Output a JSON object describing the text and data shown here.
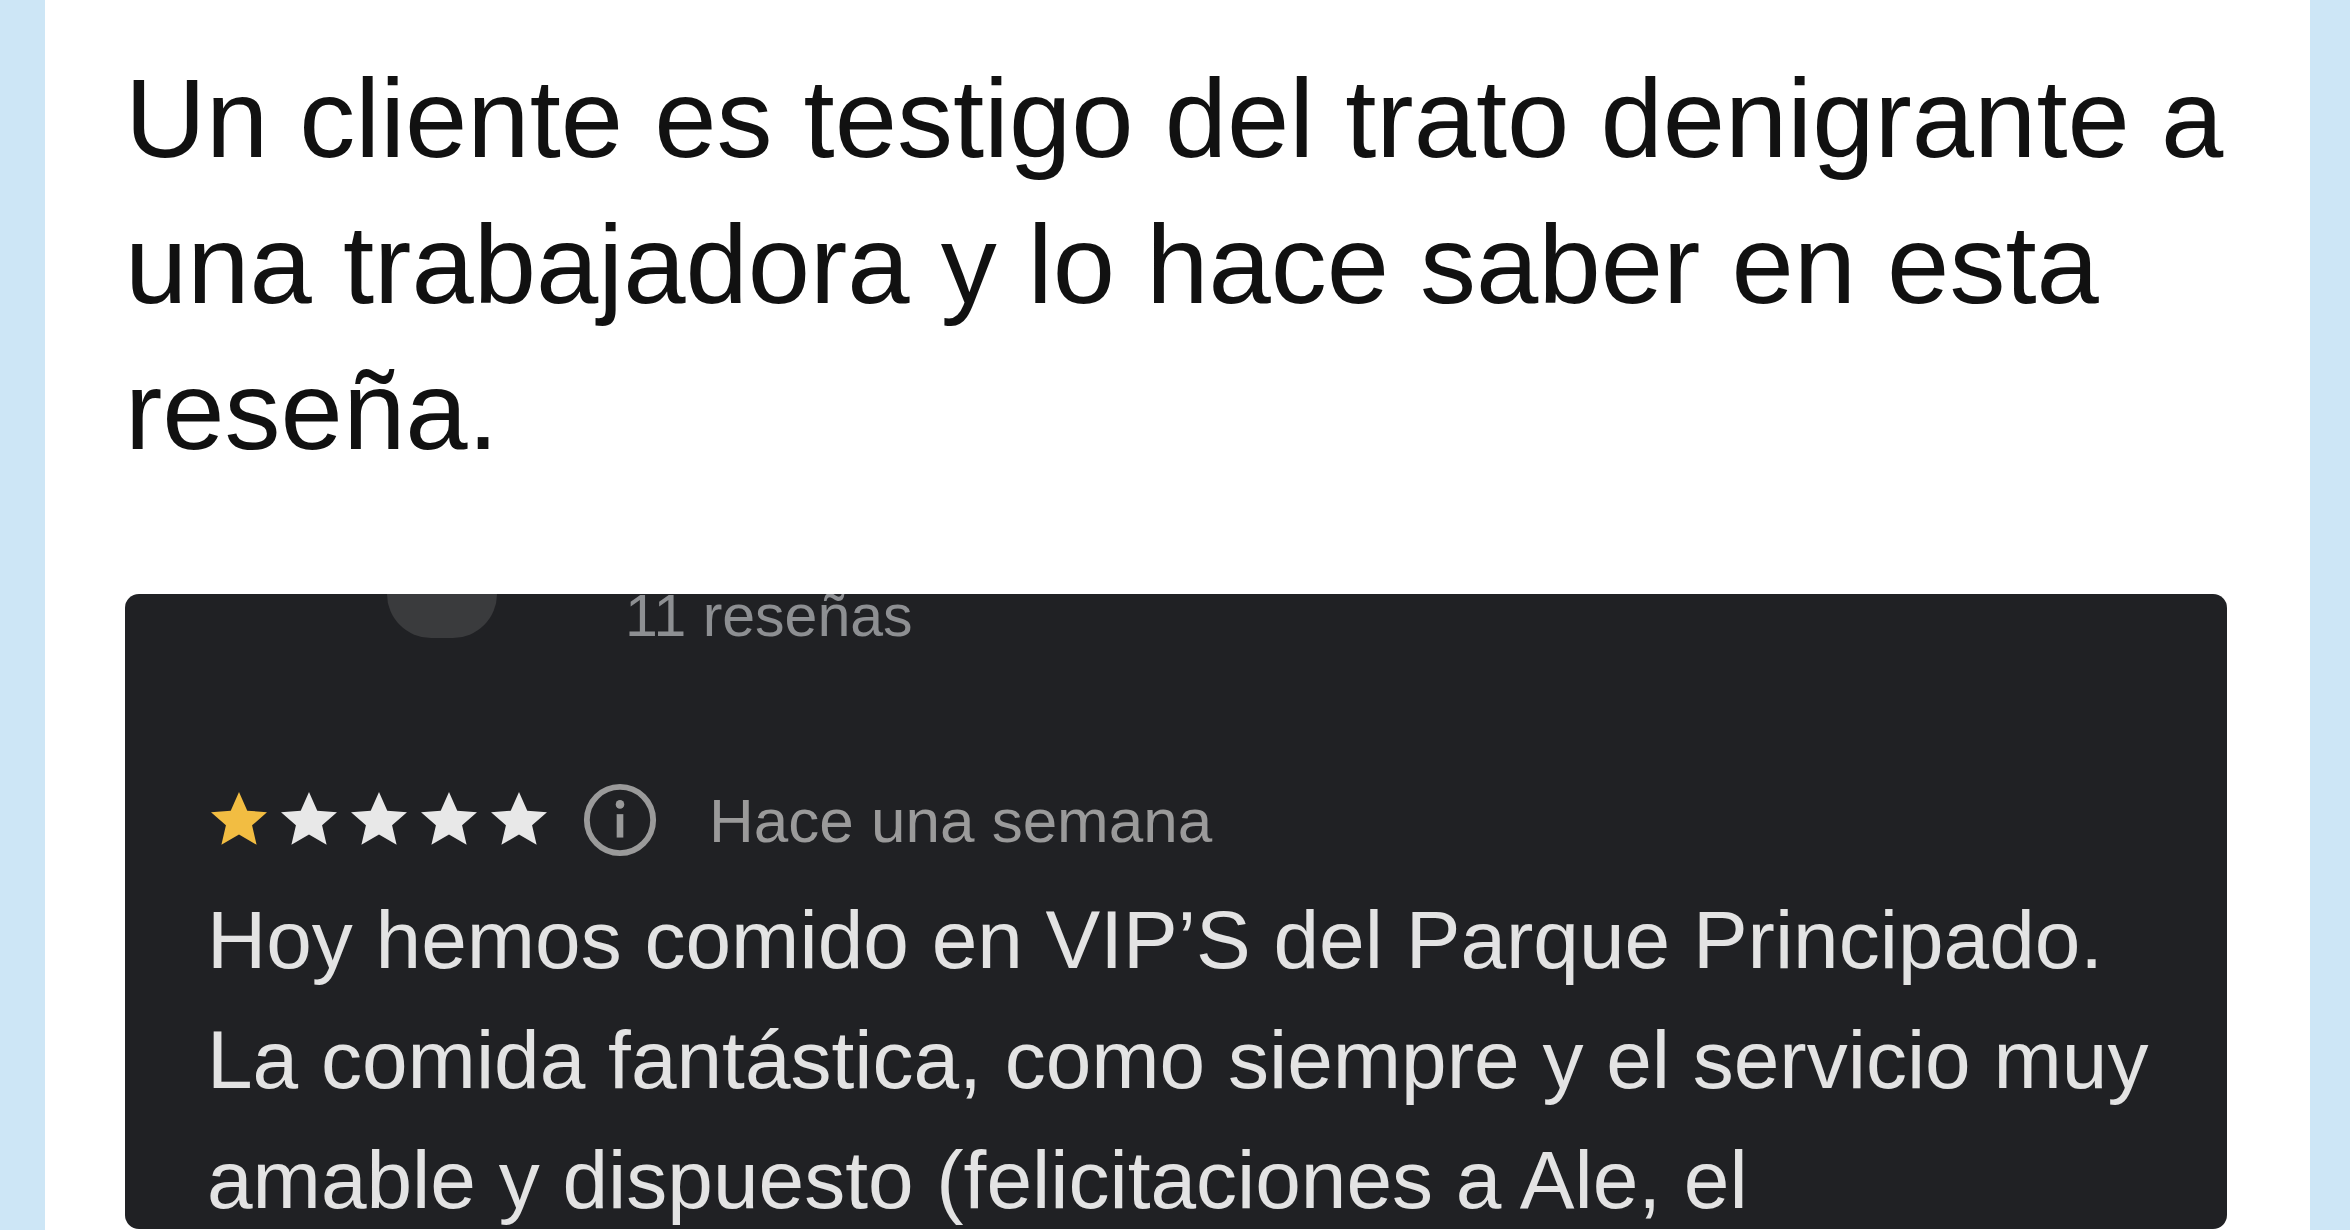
{
  "post": {
    "text": "Un cliente es testigo del trato denigrante a una trabajadora y lo hace saber en esta reseña."
  },
  "review_screenshot": {
    "review_count": "11 reseñas",
    "stars": 1,
    "time": "Hace una semana",
    "text": "Hoy hemos comido en VIP’S del Parque Principado. La comida fantástica, como siempre y el servicio muy amable y dispuesto (felicitaciones a Ale, el"
  }
}
